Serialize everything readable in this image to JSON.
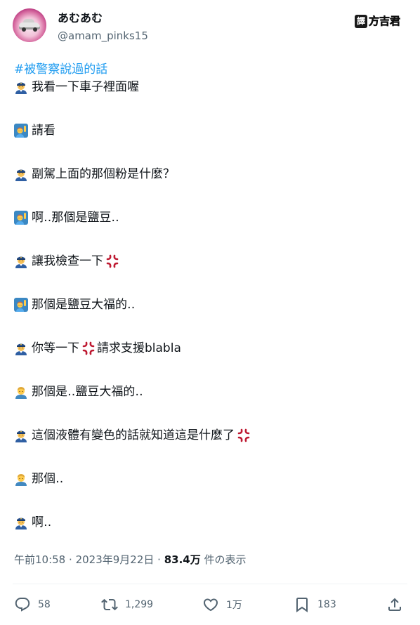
{
  "author": {
    "display_name": "あむあむ",
    "handle": "@amam_pinks15"
  },
  "watermark": {
    "box_text": "譯",
    "text": "方吉君"
  },
  "tweet": {
    "hashtag": "#被警察說過的話",
    "lines": [
      {
        "speaker": "police",
        "text": "我看一下車子裡面喔",
        "anger": false
      },
      {
        "speaker": "raised-hand",
        "text": "請看",
        "anger": false
      },
      {
        "speaker": "police",
        "text": "副駕上面的那個粉是什麼？",
        "anger": false
      },
      {
        "speaker": "raised-hand",
        "text": "啊‥那個是鹽豆‥",
        "anger": false
      },
      {
        "speaker": "police",
        "text": "讓我檢查一下",
        "anger": true
      },
      {
        "speaker": "raised-hand",
        "text": "那個是鹽豆大福的‥",
        "anger": false
      },
      {
        "speaker": "police",
        "text": "你等一下",
        "anger": true,
        "suffix": "請求支援blabla"
      },
      {
        "speaker": "person",
        "text": "那個是‥鹽豆大福的‥",
        "anger": false
      },
      {
        "speaker": "police",
        "text": "這個液體有變色的話就知道這是什麼了",
        "anger": true
      },
      {
        "speaker": "person",
        "text": "那個‥",
        "anger": false
      },
      {
        "speaker": "police",
        "text": "啊‥",
        "anger": false
      }
    ]
  },
  "meta": {
    "time": "午前10:58",
    "separator": "·",
    "date": "2023年9月22日",
    "views_count": "83.4万",
    "views_label": "件の表示"
  },
  "actions": {
    "replies": "58",
    "reposts": "1,299",
    "likes": "1万",
    "bookmarks": "183"
  },
  "colors": {
    "hashtag": "#1d9bf0",
    "secondary_text": "#536471",
    "primary_text": "#0f1419"
  }
}
